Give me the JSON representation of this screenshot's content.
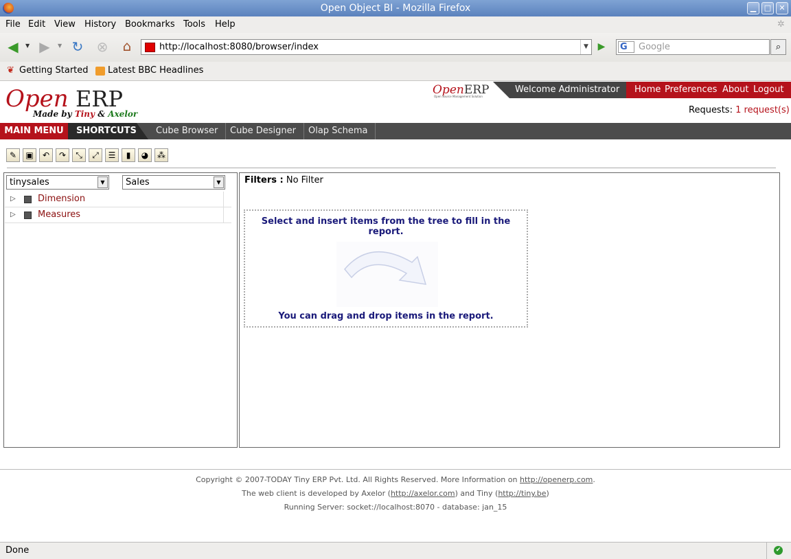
{
  "window": {
    "title": "Open Object BI - Mozilla Firefox"
  },
  "menubar": {
    "items": [
      "File",
      "Edit",
      "View",
      "History",
      "Bookmarks",
      "Tools",
      "Help"
    ]
  },
  "navigation": {
    "url": "http://localhost:8080/browser/index",
    "search_placeholder": "Google",
    "search_engine_letter": "G"
  },
  "bookmarks": {
    "items": [
      "Getting Started",
      "Latest BBC Headlines"
    ]
  },
  "header": {
    "logo_open": "Open",
    "logo_erp": "ERP",
    "logo_made_by": "Made by",
    "logo_tiny": "Tiny",
    "logo_amp": "&",
    "logo_axelor": "Axelor",
    "small_logo_open": "Open",
    "small_logo_erp": "ERP",
    "small_logo_sub": "Open Source Management Solution",
    "welcome": "Welcome Administrator",
    "links": [
      "Home",
      "Preferences",
      "About",
      "Logout"
    ],
    "requests_label": "Requests:",
    "requests_value": "1 request(s)"
  },
  "mainbar": {
    "main_menu": "MAIN MENU",
    "shortcuts": "SHORTCUTS",
    "tabs": [
      "Cube Browser",
      "Cube Designer",
      "Olap Schema"
    ]
  },
  "left": {
    "schema_select": "tinysales",
    "cube_select": "Sales",
    "tree": [
      "Dimension",
      "Measures"
    ]
  },
  "right": {
    "filters_label": "Filters :",
    "filters_value": "No Filter",
    "drop_instruction": "Select and insert items from the tree to fill in the report.",
    "drop_hint": "You can drag and drop items in the report."
  },
  "footer": {
    "line1_text": "Copyright © 2007-TODAY Tiny ERP Pvt. Ltd. All Rights Reserved. More Information on ",
    "line1_link": "http://openerp.com",
    "line1_end": ".",
    "line2_text": "The web client is developed by Axelor (",
    "line2_link1": "http://axelor.com",
    "line2_mid": ") and Tiny (",
    "line2_link2": "http://tiny.be",
    "line2_end": ")",
    "line3": "Running Server: socket://localhost:8070 - database: jan_15"
  },
  "status": {
    "text": "Done"
  },
  "colors": {
    "brand_red": "#b5121b",
    "dark_bar": "#4c4c4c",
    "link_blue_text": "#1a1a7a"
  }
}
